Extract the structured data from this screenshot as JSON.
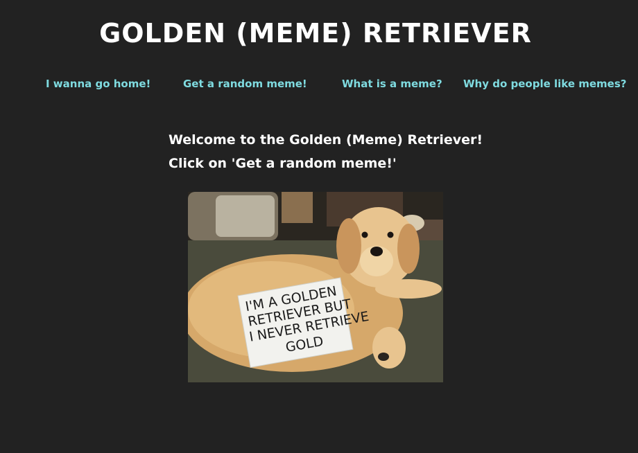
{
  "site": {
    "title": "GOLDEN (MEME) RETRIEVER"
  },
  "nav": {
    "items": [
      {
        "label": "I wanna go home!"
      },
      {
        "label": "Get a random meme!"
      },
      {
        "label": "What is a meme?"
      },
      {
        "label": "Why do people like memes?"
      }
    ]
  },
  "main": {
    "welcome_line1": "Welcome to the Golden (Meme) Retriever!",
    "welcome_line2": "Click on 'Get a random meme!'"
  },
  "meme": {
    "sign_lines": [
      "I'M A GOLDEN",
      "RETRIEVER BUT",
      "I NEVER RETRIEVE",
      "GOLD"
    ]
  },
  "colors": {
    "background": "#222222",
    "title": "#ffffff",
    "nav_link": "#7fdbe0",
    "body_text": "#ffffff"
  }
}
